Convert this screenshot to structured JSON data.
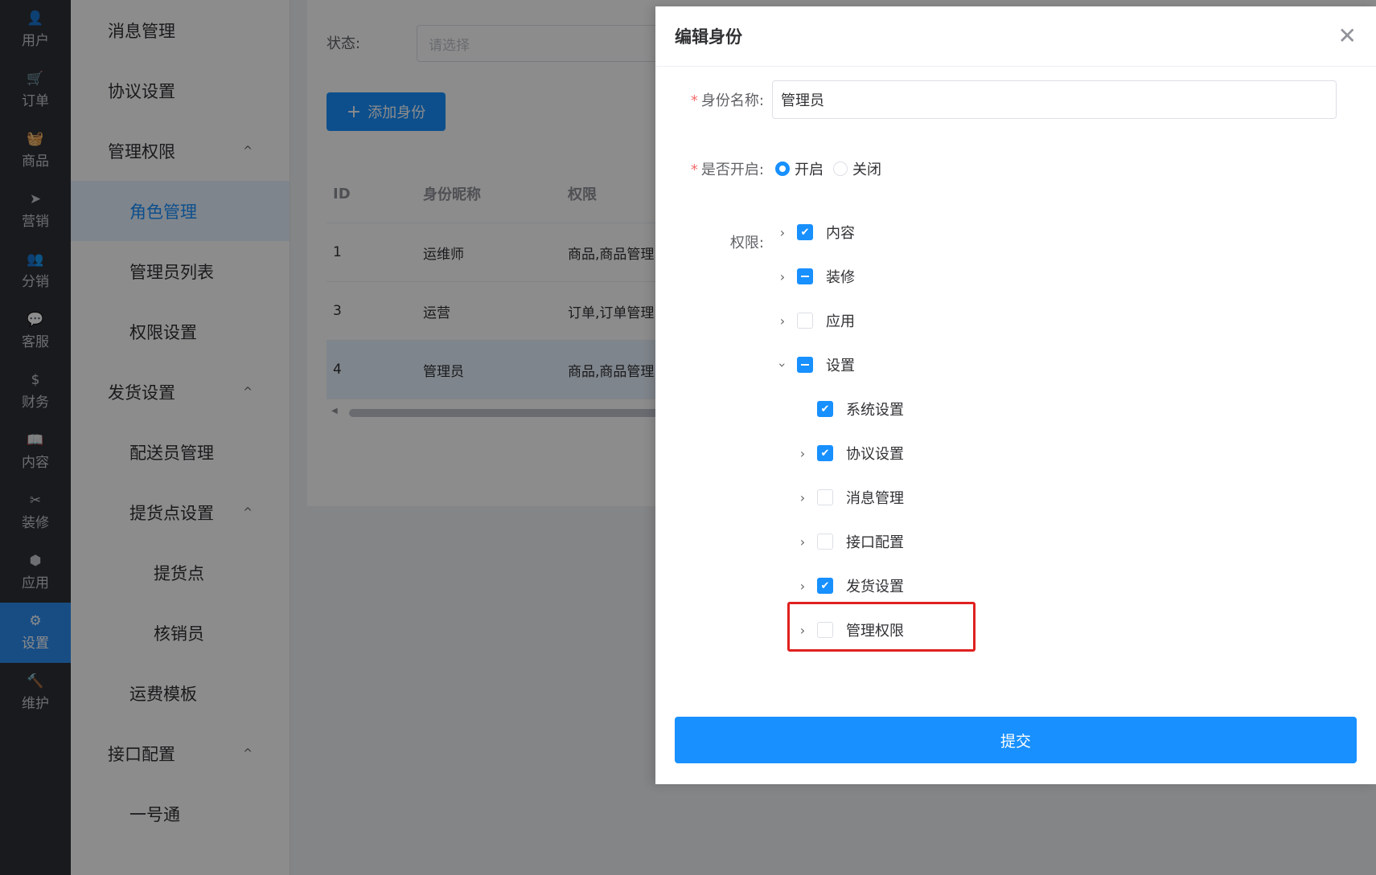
{
  "rail": [
    {
      "icon": "👤",
      "label": "用户",
      "name": "user"
    },
    {
      "icon": "🛒",
      "label": "订单",
      "name": "order"
    },
    {
      "icon": "🧺",
      "label": "商品",
      "name": "goods"
    },
    {
      "icon": "➤",
      "label": "营销",
      "name": "marketing"
    },
    {
      "icon": "👥",
      "label": "分销",
      "name": "distribution"
    },
    {
      "icon": "💬",
      "label": "客服",
      "name": "service"
    },
    {
      "icon": "$",
      "label": "财务",
      "name": "finance"
    },
    {
      "icon": "📖",
      "label": "内容",
      "name": "content"
    },
    {
      "icon": "✂",
      "label": "装修",
      "name": "decorate"
    },
    {
      "icon": "⬢",
      "label": "应用",
      "name": "app"
    },
    {
      "icon": "⚙",
      "label": "设置",
      "name": "settings",
      "active": true
    },
    {
      "icon": "🔨",
      "label": "维护",
      "name": "maintain"
    }
  ],
  "submenu": [
    {
      "label": "消息管理",
      "level": 1
    },
    {
      "label": "协议设置",
      "level": 1
    },
    {
      "label": "管理权限",
      "level": 1,
      "caret": "^"
    },
    {
      "label": "角色管理",
      "level": 2,
      "active": true
    },
    {
      "label": "管理员列表",
      "level": 2
    },
    {
      "label": "权限设置",
      "level": 2
    },
    {
      "label": "发货设置",
      "level": 1,
      "caret": "^"
    },
    {
      "label": "配送员管理",
      "level": 2
    },
    {
      "label": "提货点设置",
      "level": 2,
      "caret": "^"
    },
    {
      "label": "提货点",
      "level": 3
    },
    {
      "label": "核销员",
      "level": 3
    },
    {
      "label": "运费模板",
      "level": 2
    },
    {
      "label": "接口配置",
      "level": 1,
      "caret": "^"
    },
    {
      "label": "一号通",
      "level": 2
    }
  ],
  "main": {
    "filter_label": "状态:",
    "filter_placeholder": "请选择",
    "add_button": "添加身份",
    "table": {
      "headers": [
        "ID",
        "身份昵称",
        "权限"
      ],
      "rows": [
        [
          "1",
          "运维师",
          "商品,商品管理"
        ],
        [
          "3",
          "运营",
          "订单,订单管理"
        ],
        [
          "4",
          "管理员",
          "商品,商品管理"
        ]
      ]
    }
  },
  "dialog": {
    "title": "编辑身份",
    "name_label": "身份名称:",
    "name_value": "管理员",
    "enable_label": "是否开启:",
    "radio_on": "开启",
    "radio_off": "关闭",
    "perm_label": "权限:",
    "submit": "提交",
    "tree": [
      {
        "label": "内容",
        "state": "checked",
        "arrow": "right",
        "indent": 0
      },
      {
        "label": "装修",
        "state": "indeterminate",
        "arrow": "right",
        "indent": 0
      },
      {
        "label": "应用",
        "state": "unchecked",
        "arrow": "right",
        "indent": 0
      },
      {
        "label": "设置",
        "state": "indeterminate",
        "arrow": "down",
        "indent": 0
      },
      {
        "label": "系统设置",
        "state": "checked",
        "arrow": "none",
        "indent": 1
      },
      {
        "label": "协议设置",
        "state": "checked",
        "arrow": "right",
        "indent": 1
      },
      {
        "label": "消息管理",
        "state": "unchecked",
        "arrow": "right",
        "indent": 1
      },
      {
        "label": "接口配置",
        "state": "unchecked",
        "arrow": "right",
        "indent": 1
      },
      {
        "label": "发货设置",
        "state": "checked",
        "arrow": "right",
        "indent": 1
      },
      {
        "label": "管理权限",
        "state": "unchecked",
        "arrow": "right",
        "indent": 1
      }
    ]
  },
  "colors": {
    "accent": "#1890ff",
    "rail_bg": "#2f3136",
    "highlight": "#e02020"
  }
}
